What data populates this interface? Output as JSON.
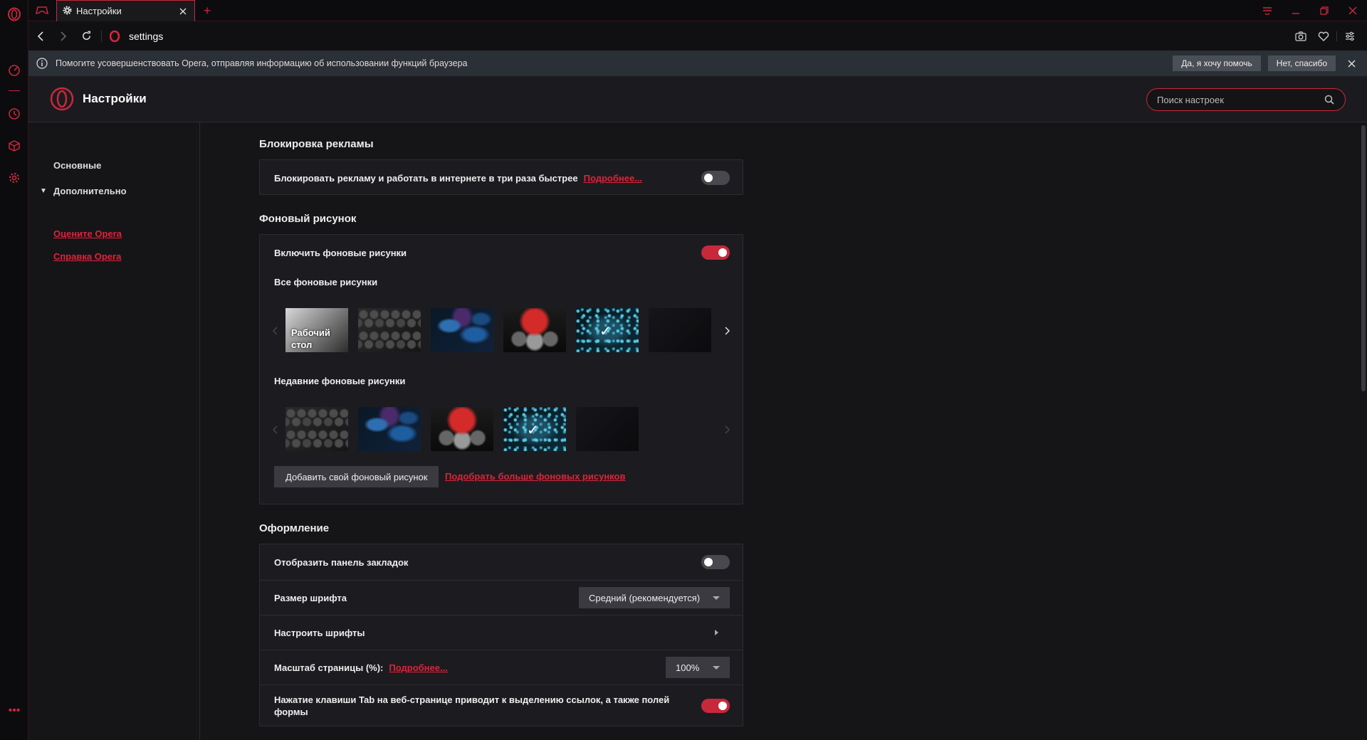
{
  "tabs": [
    {
      "title": "Настройки"
    }
  ],
  "addressbar": {
    "url": "settings"
  },
  "infobar": {
    "text": "Помогите усовершенствовать Opera, отправляя информацию об использовании функций браузера",
    "yes_label": "Да, я хочу помочь",
    "no_label": "Нет, спасибо"
  },
  "header": {
    "title": "Настройки",
    "search_placeholder": "Поиск настроек"
  },
  "leftnav": {
    "basic": "Основные",
    "advanced": "Дополнительно",
    "rate": "Оцените Opera",
    "help": "Справка Opera"
  },
  "adblock": {
    "title": "Блокировка рекламы",
    "row_label": "Блокировать рекламу и работать в интернете в три раза быстрее",
    "more_link": "Подробнее...",
    "enabled": false
  },
  "wallpaper": {
    "title": "Фоновый рисунок",
    "enable_label": "Включить фоновые рисунки",
    "enabled": true,
    "all_label": "Все фоновые рисунки",
    "recent_label": "Недавние фоновые рисунки",
    "all_items": [
      {
        "label": "Рабочий стол",
        "style": "desk",
        "selected": false
      },
      {
        "style": "leather",
        "selected": false
      },
      {
        "style": "leaves",
        "selected": false
      },
      {
        "style": "engine",
        "selected": false
      },
      {
        "style": "particles",
        "selected": true
      },
      {
        "style": "dark",
        "selected": false
      }
    ],
    "recent_items": [
      {
        "style": "leather",
        "selected": false
      },
      {
        "style": "leaves",
        "selected": false
      },
      {
        "style": "engine",
        "selected": false
      },
      {
        "style": "particles",
        "selected": true
      },
      {
        "style": "dark",
        "selected": false
      }
    ],
    "add_button": "Добавить свой фоновый рисунок",
    "more_link": "Подобрать больше фоновых рисунков"
  },
  "appearance": {
    "title": "Оформление",
    "bookmarks_label": "Отобразить панель закладок",
    "bookmarks_enabled": false,
    "font_size_label": "Размер шрифта",
    "font_size_value": "Средний (рекомендуется)",
    "fonts_label": "Настроить шрифты",
    "zoom_label": "Масштаб страницы (%):",
    "zoom_more": "Подробнее...",
    "zoom_value": "100%",
    "tab_highlight_label": "Нажатие клавиши Tab на веб-странице приводит к выделению ссылок, а также полей формы",
    "tab_highlight_enabled": true
  },
  "colors": {
    "accent": "#c8283c",
    "link": "#e0223a",
    "background": "#151518",
    "card": "#1c1c20"
  }
}
